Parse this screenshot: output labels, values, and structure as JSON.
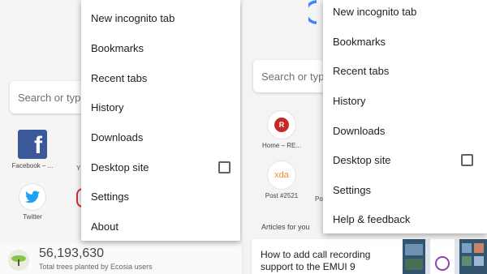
{
  "left": {
    "search_placeholder": "Search or type",
    "tiles": [
      {
        "label": "Facebook – ..."
      },
      {
        "label": "Twitter"
      }
    ],
    "menu_items": [
      "New incognito tab",
      "Bookmarks",
      "Recent tabs",
      "History",
      "Downloads",
      "Desktop site",
      "Settings",
      "About"
    ],
    "stats": {
      "value": "56,193,630",
      "label": "Total trees planted by Ecosia users"
    }
  },
  "right": {
    "search_placeholder": "Search or type",
    "tiles": [
      {
        "label": "Home – RE...",
        "letter": "R"
      },
      {
        "label": "Post #2521",
        "icon_text": "xda"
      },
      {
        "label": "Po"
      }
    ],
    "menu_items": [
      "New incognito tab",
      "Bookmarks",
      "Recent tabs",
      "History",
      "Downloads",
      "Desktop site",
      "Settings",
      "Help & feedback"
    ],
    "articles_label": "Articles for you",
    "article_title": "How to add call recording support to the EMUI 9"
  },
  "colors": {
    "facebook": "#3b5998",
    "twitter": "#1da1f2",
    "recent_red": "#c62828",
    "xda_orange": "#f28b30"
  }
}
